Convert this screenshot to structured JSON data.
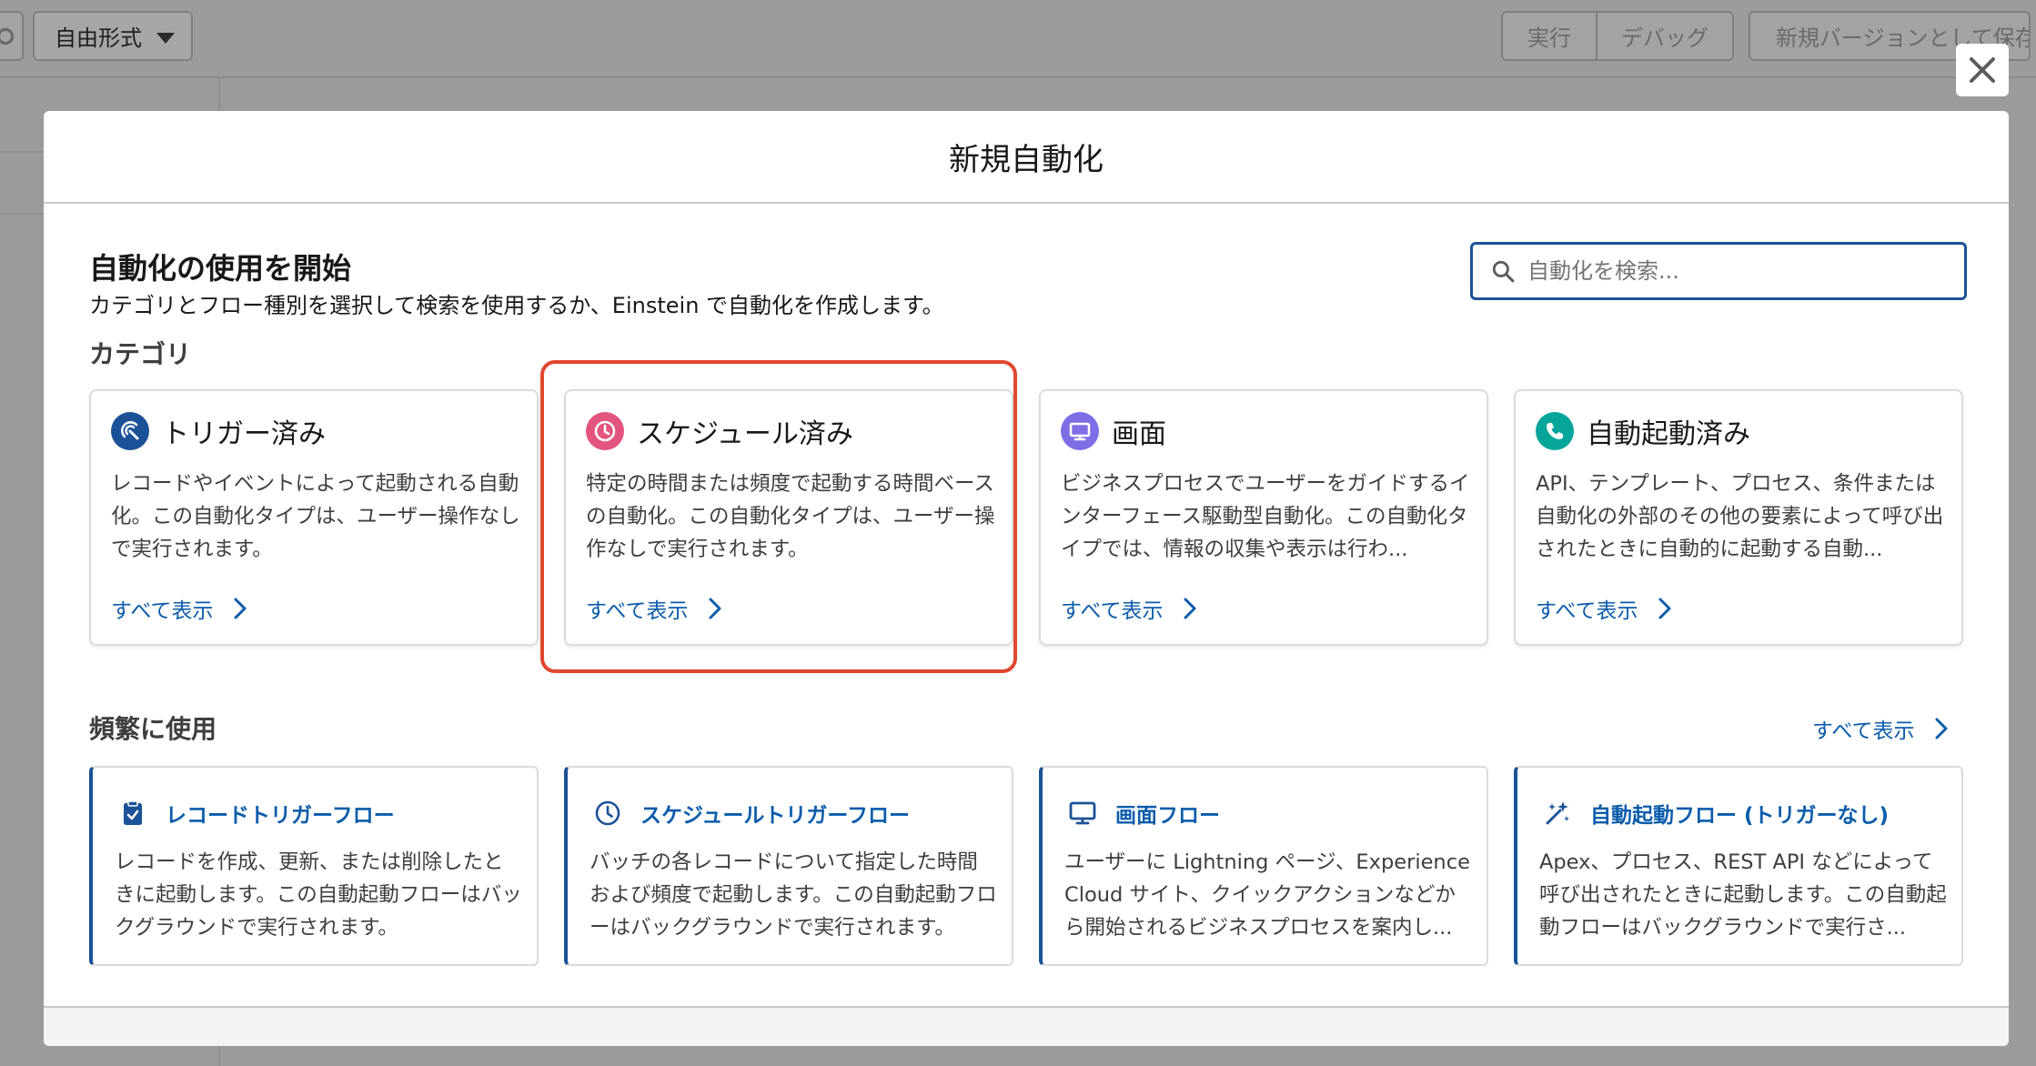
{
  "toolbar": {
    "mode_label": "自由形式",
    "run_label": "実行",
    "debug_label": "デバッグ",
    "save_as_label": "新規バージョンとして保存"
  },
  "modal": {
    "title": "新規自動化",
    "close_icon": "close-icon"
  },
  "intro": {
    "title": "自動化の使用を開始",
    "description": "カテゴリとフロー種別を選択して検索を使用するか、Einstein で自動化を作成します。"
  },
  "search": {
    "placeholder": "自動化を検索...",
    "value": ""
  },
  "categories": {
    "heading": "カテゴリ",
    "items": [
      {
        "title": "トリガー済み",
        "description": "レコードやイベントによって起動される自動化。この自動化タイプは、ユーザー操作なしで実行されます。",
        "link": "すべて表示",
        "icon": "trigger-icon",
        "color": "#1b5297"
      },
      {
        "title": "スケジュール済み",
        "description": "特定の時間または頻度で起動する時間ベースの自動化。この自動化タイプは、ユーザー操作なしで実行されます。",
        "link": "すべて表示",
        "icon": "clock-icon",
        "color": "#e3547e"
      },
      {
        "title": "画面",
        "description": "ビジネスプロセスでユーザーをガイドするインターフェース駆動型自動化。この自動化タイプでは、情報の収集や表示は行わ...",
        "link": "すべて表示",
        "icon": "monitor-icon",
        "color": "#7d6ee6"
      },
      {
        "title": "自動起動済み",
        "description": "API、テンプレート、プロセス、条件または自動化の外部のその他の要素によって呼び出されたときに自動的に起動する自動...",
        "link": "すべて表示",
        "icon": "phone-icon",
        "color": "#06a59a"
      }
    ]
  },
  "frequent": {
    "heading": "頻繁に使用",
    "see_all": "すべて表示",
    "items": [
      {
        "title": "レコードトリガーフロー",
        "description": "レコードを作成、更新、または削除したときに起動します。この自動起動フローはバックグラウンドで実行されます。",
        "icon": "record-clipboard-icon"
      },
      {
        "title": "スケジュールトリガーフロー",
        "description": "バッチの各レコードについて指定した時間および頻度で起動します。この自動起動フローはバックグラウンドで実行されます。",
        "icon": "clock-icon"
      },
      {
        "title": "画面フロー",
        "description": "ユーザーに Lightning ページ、Experience Cloud サイト、クイックアクションなどから開始されるビジネスプロセスを案内し...",
        "icon": "monitor-icon"
      },
      {
        "title": "自動起動フロー (トリガーなし)",
        "description": "Apex、プロセス、REST API などによって呼び出されたときに起動します。この自動起動フローはバックグラウンドで実行さ...",
        "icon": "magic-wand-icon"
      }
    ]
  },
  "colors": {
    "accent": "#0b5cab",
    "highlight": "#e0472f"
  }
}
